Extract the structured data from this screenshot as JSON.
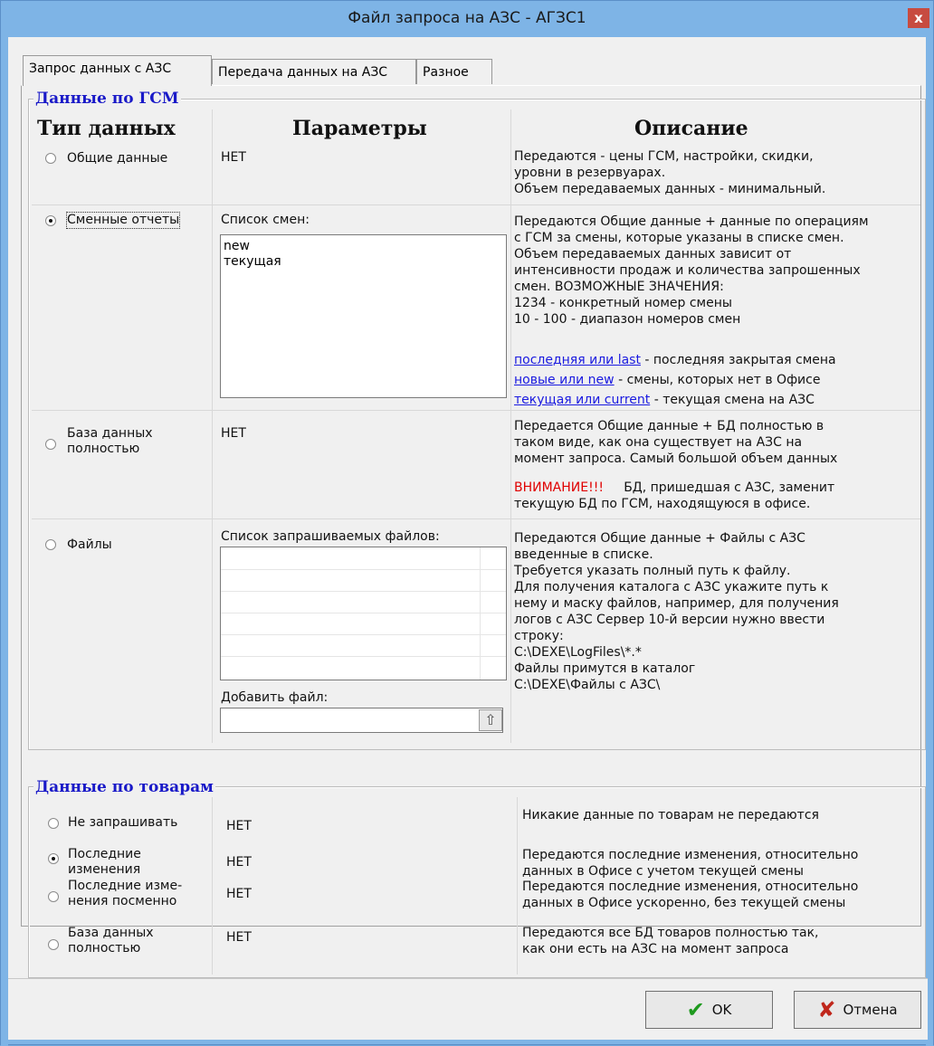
{
  "window": {
    "title": "Файл запроса на АЗС - АГЗС1",
    "close_glyph": "x"
  },
  "tabs": [
    "Запрос данных с АЗС",
    "Передача данных на АЗС",
    "Разное"
  ],
  "gsm": {
    "legend": "Данные по ГСМ",
    "headers": {
      "type": "Тип данных",
      "params": "Параметры",
      "desc": "Описание"
    },
    "rows": [
      {
        "label": "Общие данные",
        "selected": false,
        "param": "НЕТ",
        "desc": "Передаются - цены ГСМ, настройки, скидки,\nуровни в резервуарах.\nОбъем передаваемых данных - минимальный."
      },
      {
        "label": "Сменные отчеты",
        "selected": true,
        "param_label": "Список смен:",
        "shift_list": [
          "new",
          "текущая"
        ],
        "desc": "Передаются Общие данные + данные по операциям\nс ГСМ за смены, которые указаны в списке смен.\nОбъем передаваемых данных зависит от\nинтенсивности продаж и количества запрошенных\nсмен. ВОЗМОЖНЫЕ ЗНАЧЕНИЯ:\n1234 - конкретный номер смены\n10 - 100 - диапазон номеров смен",
        "links": [
          {
            "link": "последняя или last",
            "text": " - последняя закрытая смена"
          },
          {
            "link": "новые или new",
            "text": " - смены, которых нет в Офисе"
          },
          {
            "link": "текущая или current",
            "text": " - текущая смена на АЗС"
          }
        ]
      },
      {
        "label": "База данных\nполностью",
        "selected": false,
        "param": "НЕТ",
        "desc1": "Передается Общие данные + БД полностью в\nтаком виде, как она существует на АЗС на\nмомент запроса. Самый большой объем данных",
        "warn": "ВНИМАНИЕ!!!",
        "desc2": "     БД, пришедшая с АЗС, заменит",
        "desc3": "текущую БД по ГСМ, находящуюся в офисе."
      },
      {
        "label": "Файлы",
        "selected": false,
        "param_label": "Список запрашиваемых файлов:",
        "add_label": "Добавить файл:",
        "add_value": "",
        "up_glyph": "⇧",
        "desc": "Передаются Общие данные + Файлы с АЗС\nвведенные в списке.\nТребуется указать полный путь к файлу.\nДля получения каталога с АЗС укажите путь к\nнему и маску файлов, например, для получения\nлогов с АЗС Сервер 10-й версии нужно ввести\nстроку:\nC:\\DEXE\\LogFiles\\*.*\nФайлы примутся в каталог\nC:\\DEXE\\Файлы с АЗС\\"
      }
    ]
  },
  "goods": {
    "legend": "Данные по товарам",
    "rows": [
      {
        "label": "Не запрашивать",
        "selected": false,
        "param": "НЕТ",
        "desc": "Никакие данные по товарам не передаются"
      },
      {
        "label": "Последние\nизменения",
        "selected": true,
        "param": "НЕТ",
        "desc": "Передаются последние изменения, относительно\nданных в Офисе с учетом текущей смены"
      },
      {
        "label": "Последние изме-\nнения посменно",
        "selected": false,
        "param": "НЕТ",
        "desc": "Передаются последние изменения, относительно\nданных в Офисе ускоренно, без текущей смены"
      },
      {
        "label": "База данных\nполностью",
        "selected": false,
        "param": "НЕТ",
        "desc": "Передаются все БД товаров полностью так,\nкак они есть на АЗС на момент запроса"
      }
    ]
  },
  "buttons": {
    "ok": "OK",
    "ok_glyph": "✔",
    "cancel": "Отмена",
    "cancel_glyph": "✘"
  }
}
